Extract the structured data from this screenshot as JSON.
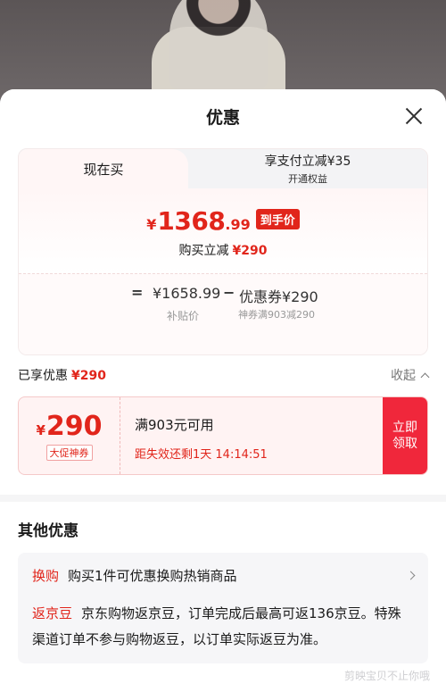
{
  "sheet": {
    "title": "优惠"
  },
  "tabs": [
    {
      "label": "现在买"
    },
    {
      "label": "享支付立减¥35",
      "sub": "开通权益"
    }
  ],
  "price": {
    "currency": "¥",
    "integer": "1368",
    "decimal": ".99",
    "badge": "到手价",
    "reduce_label": "购买立减",
    "reduce_value": "¥290"
  },
  "formula": {
    "eq": "=",
    "base_price": "¥1658.99",
    "base_label": "补贴价",
    "minus": "−",
    "coupon": "优惠券¥290",
    "coupon_label": "神券满903减290"
  },
  "enjoyed": {
    "label": "已享优惠",
    "value": "¥290",
    "collapse": "收起"
  },
  "coupon": {
    "currency": "¥",
    "amount": "290",
    "tag": "大促神券",
    "condition": "满903元可用",
    "expiry": "距失效还剩1天 14:14:51",
    "button": "立即领取"
  },
  "others": {
    "title": "其他优惠",
    "exchange_tag": "换购",
    "exchange_text": "购买1件可优惠换购热销商品",
    "bean_tag": "返京豆",
    "bean_text": "京东购物返京豆，订单完成后最高可返136京豆。特殊渠道订单不参与购物返豆，以订单实际返豆为准。"
  },
  "watermark": "剪映宝贝不止你哦",
  "colors": {
    "accent": "#e1251b",
    "button": "#f0273b",
    "icon_close": "close-icon"
  }
}
